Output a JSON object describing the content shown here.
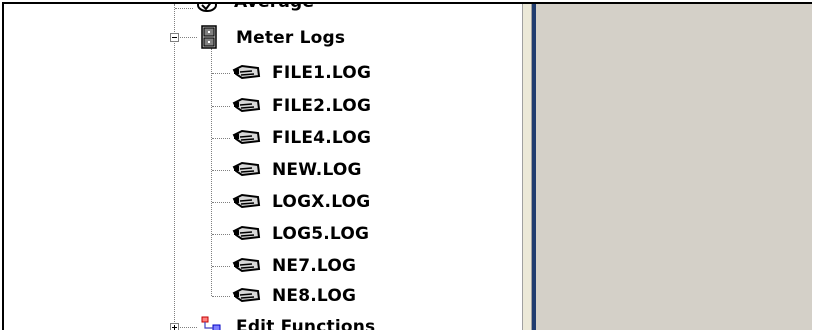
{
  "tree": {
    "partial_item": {
      "label": "Average",
      "icon": "average-icon"
    },
    "folder": {
      "label": "Meter Logs",
      "icon": "meter-logs-folder-icon",
      "expanded": true,
      "children": [
        {
          "label": "FILE1.LOG",
          "icon": "log-file-icon"
        },
        {
          "label": "FILE2.LOG",
          "icon": "log-file-icon"
        },
        {
          "label": "FILE4.LOG",
          "icon": "log-file-icon"
        },
        {
          "label": "NEW.LOG",
          "icon": "log-file-icon"
        },
        {
          "label": "LOGX.LOG",
          "icon": "log-file-icon"
        },
        {
          "label": "LOG5.LOG",
          "icon": "log-file-icon"
        },
        {
          "label": "NE7.LOG",
          "icon": "log-file-icon"
        },
        {
          "label": "NE8.LOG",
          "icon": "log-file-icon"
        }
      ]
    },
    "next_item": {
      "label": "Edit Functions",
      "icon": "edit-functions-icon",
      "expanded": false
    }
  },
  "colors": {
    "right_pane": "#d4d0c8",
    "divider": "#1f3b6e",
    "tree_line": "#808080"
  }
}
